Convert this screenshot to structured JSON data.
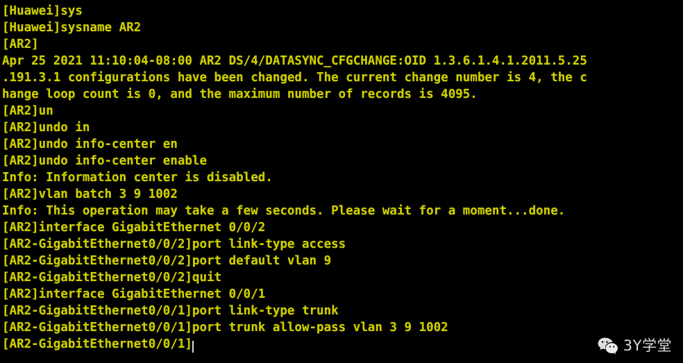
{
  "terminal": {
    "title": "Huawei eNSP CLI",
    "colors": {
      "background": "#000000",
      "foreground": "#cfcf00",
      "cursor": "#d8d8d8"
    },
    "cursor": {
      "visible": true,
      "line_index": 20,
      "shape": "bar"
    },
    "lines": [
      "[Huawei]sys",
      "[Huawei]sysname AR2",
      "[AR2]",
      "Apr 25 2021 11:10:04-08:00 AR2 DS/4/DATASYNC_CFGCHANGE:OID 1.3.6.1.4.1.2011.5.25",
      ".191.3.1 configurations have been changed. The current change number is 4, the c",
      "hange loop count is 0, and the maximum number of records is 4095.",
      "[AR2]un",
      "[AR2]undo in",
      "[AR2]undo info-center en",
      "[AR2]undo info-center enable",
      "Info: Information center is disabled.",
      "[AR2]vlan batch 3 9 1002",
      "Info: This operation may take a few seconds. Please wait for a moment...done.",
      "[AR2]interface GigabitEthernet 0/0/2",
      "[AR2-GigabitEthernet0/0/2]port link-type access",
      "[AR2-GigabitEthernet0/0/2]port default vlan 9",
      "[AR2-GigabitEthernet0/0/2]quit",
      "[AR2]interface GigabitEthernet 0/0/1",
      "[AR2-GigabitEthernet0/0/1]port link-type trunk",
      "[AR2-GigabitEthernet0/0/1]port trunk allow-pass vlan 3 9 1002",
      "[AR2-GigabitEthernet0/0/1]"
    ]
  },
  "watermark": {
    "icon": "wechat-icon",
    "text": "3Y学堂",
    "color": "#ededed"
  }
}
